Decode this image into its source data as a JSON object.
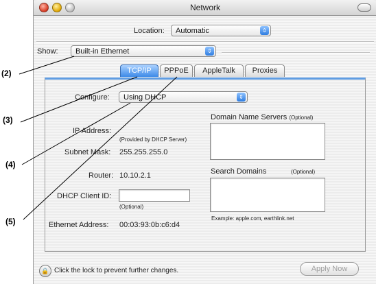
{
  "callouts": [
    "(2)",
    "(3)",
    "(4)",
    "(5)"
  ],
  "window": {
    "title": "Network"
  },
  "location": {
    "label": "Location:",
    "value": "Automatic"
  },
  "show": {
    "label": "Show:",
    "value": "Built-in Ethernet"
  },
  "tabs": [
    {
      "label": "TCP/IP",
      "active": true
    },
    {
      "label": "PPPoE",
      "active": false
    },
    {
      "label": "AppleTalk",
      "active": false
    },
    {
      "label": "Proxies",
      "active": false
    }
  ],
  "configure": {
    "label": "Configure:",
    "value": "Using DHCP"
  },
  "ip_address": {
    "label": "IP Address:",
    "note": "(Provided by DHCP Server)"
  },
  "subnet_mask": {
    "label": "Subnet Mask:",
    "value": "255.255.255.0"
  },
  "router": {
    "label": "Router:",
    "value": "10.10.2.1"
  },
  "dhcp_client_id": {
    "label": "DHCP Client ID:",
    "note": "(Optional)",
    "value": ""
  },
  "ethernet_address": {
    "label": "Ethernet Address:",
    "value": "00:03:93:0b:c6:d4"
  },
  "dns": {
    "title": "Domain Name Servers",
    "note": "(Optional)"
  },
  "search_domains": {
    "title": "Search Domains",
    "note": "(Optional)",
    "example": "Example: apple.com, earthlink.net"
  },
  "footer": {
    "lock_text": "Click the lock to prevent further changes.",
    "apply_label": "Apply Now"
  },
  "colors": {
    "accent_blue": "#3d8ae8",
    "close_red": "#d63a22",
    "minimize_yellow": "#e0a500"
  }
}
